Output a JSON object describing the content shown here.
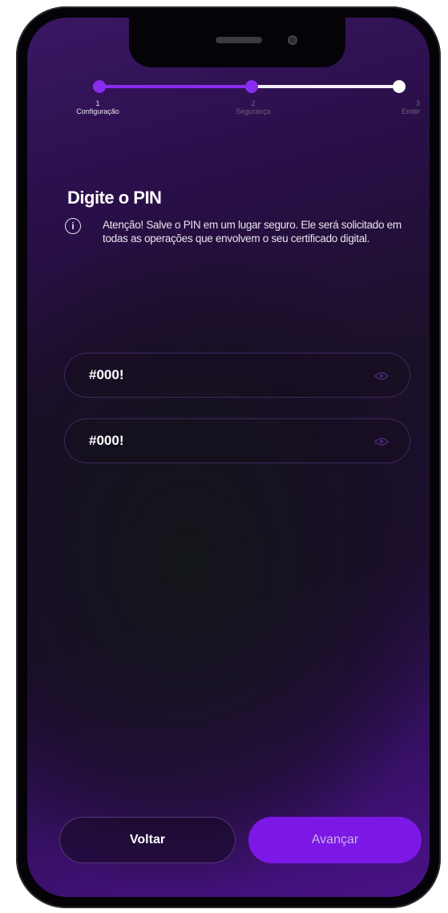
{
  "stepper": {
    "steps": [
      {
        "number": "1",
        "label": "Configuração",
        "state": "done"
      },
      {
        "number": "2",
        "label": "Segurança",
        "state": "current"
      },
      {
        "number": "3",
        "label": "Emitir",
        "state": "pending"
      }
    ],
    "progress": 0.5
  },
  "page": {
    "title": "Digite o PIN",
    "info_icon": "info-circle-icon",
    "notice": "Atenção! Salve o PIN em um lugar seguro. Ele será solicitado em todas as operações que envolvem o seu certificado digital."
  },
  "pin_fields": [
    {
      "value": "#000!",
      "icon": "eye-icon"
    },
    {
      "value": "#000!",
      "icon": "eye-icon"
    }
  ],
  "actions": {
    "back_label": "Voltar",
    "next_label": "Avançar"
  },
  "colors": {
    "accent": "#7c18e6",
    "step_done": "#8a2cf0",
    "step_pending": "#f4f0f8",
    "background_top": "#3a1763",
    "background_bottom": "#4a1289"
  }
}
